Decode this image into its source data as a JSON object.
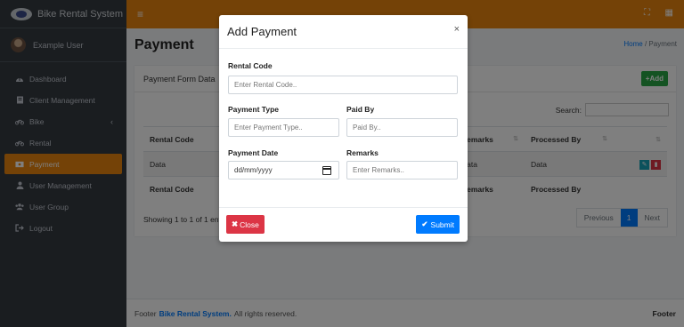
{
  "app": {
    "brand": "Bike Rental System",
    "user": "Example User"
  },
  "sidebar": {
    "items": [
      {
        "label": "Dashboard",
        "icon": "dashboard-icon"
      },
      {
        "label": "Client Management",
        "icon": "client-icon"
      },
      {
        "label": "Bike",
        "icon": "bike-icon",
        "has_arrow": true
      },
      {
        "label": "Rental",
        "icon": "bike-icon"
      },
      {
        "label": "Payment",
        "icon": "payment-icon",
        "active": true
      },
      {
        "label": "User Management",
        "icon": "user-icon"
      },
      {
        "label": "User Group",
        "icon": "users-icon"
      },
      {
        "label": "Logout",
        "icon": "logout-icon"
      }
    ]
  },
  "topbar": {
    "menu_glyph": "≡",
    "expand_glyph": "⛶",
    "grid_glyph": "▦"
  },
  "page": {
    "title": "Payment",
    "breadcrumb_home": "Home",
    "breadcrumb_sep": "/",
    "breadcrumb_current": "Payment"
  },
  "card": {
    "title": "Payment Form Data",
    "add_label": "+Add",
    "search_label": "Search:",
    "columns": [
      "Rental Code",
      "Remarks",
      "Processed By"
    ],
    "row": [
      "Data",
      "Data",
      "Data"
    ],
    "showing": "Showing 1 to 1 of 1 ent",
    "pager": {
      "previous": "Previous",
      "current": "1",
      "next": "Next"
    }
  },
  "footer": {
    "prefix": "Footer",
    "link": "Bike Rental System.",
    "rights": "All rights reserved.",
    "right": "Footer"
  },
  "modal": {
    "title": "Add Payment",
    "close_glyph": "×",
    "fields": {
      "rental_code": {
        "label": "Rental Code",
        "placeholder": "Enter Rental Code.."
      },
      "payment_type": {
        "label": "Payment Type",
        "placeholder": "Enter Payment Type.."
      },
      "paid_by": {
        "label": "Paid By",
        "placeholder": "Paid By.."
      },
      "payment_date": {
        "label": "Payment Date",
        "placeholder": "dd/mm/yyyy"
      },
      "remarks": {
        "label": "Remarks",
        "placeholder": "Enter Remarks.."
      }
    },
    "close_button": "Close",
    "submit_button": "Submit"
  },
  "colors": {
    "accent": "#e8850e",
    "sidebar": "#343a40",
    "primary": "#007bff",
    "danger": "#dc3545",
    "success": "#28a745"
  }
}
